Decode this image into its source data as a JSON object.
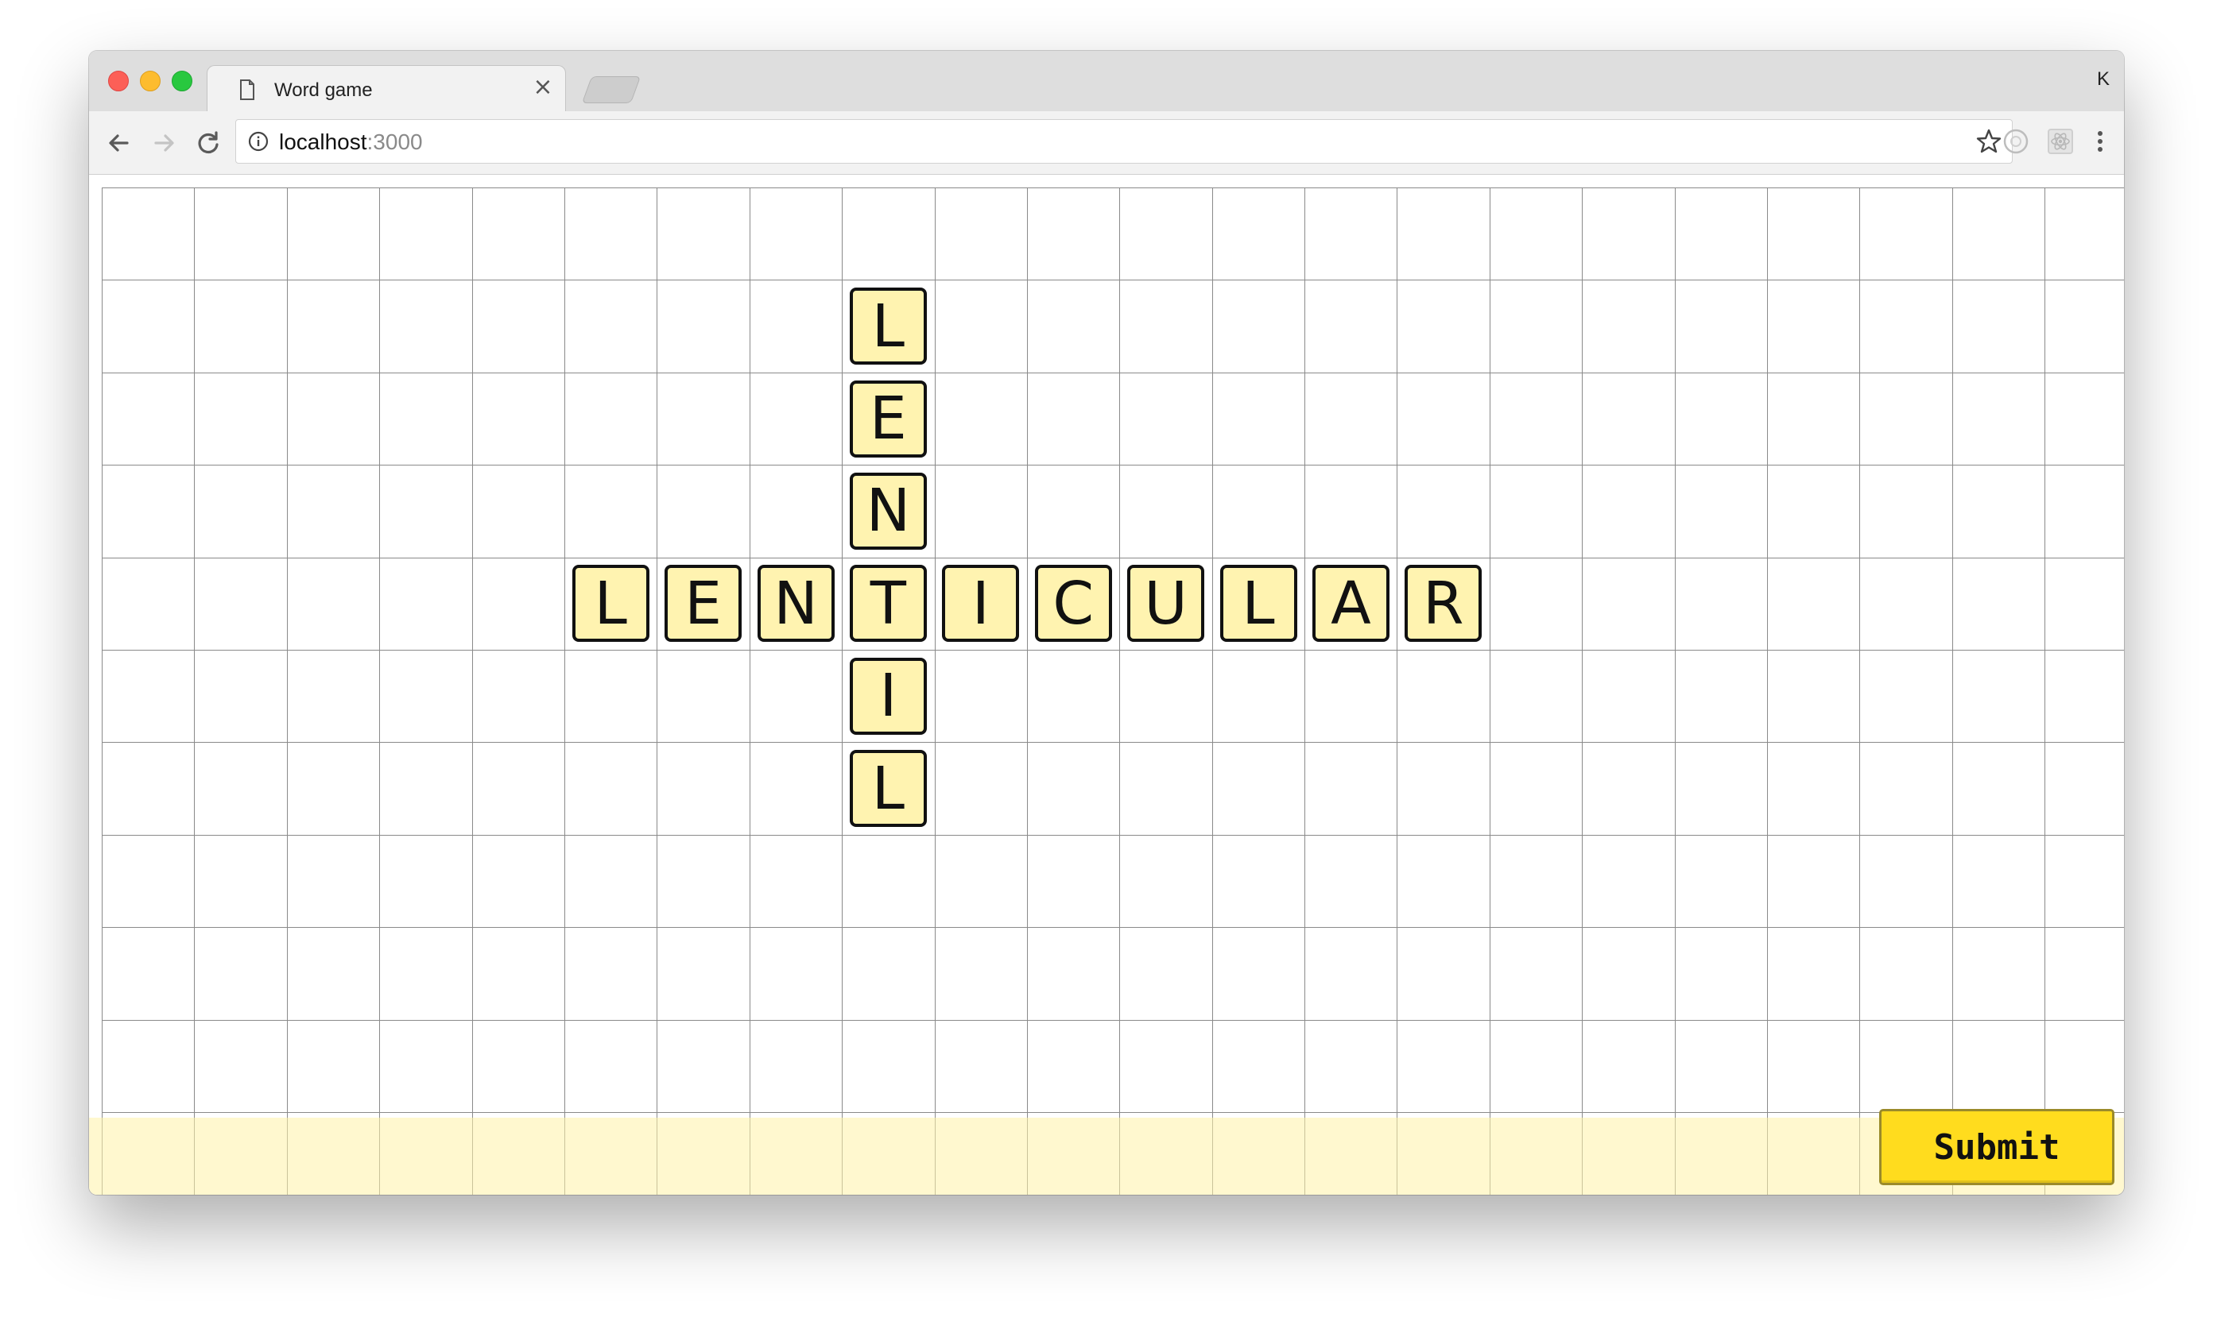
{
  "browser": {
    "tab_title": "Word game",
    "tab_close": "×",
    "profile_initial": "K",
    "url_host": "localhost",
    "url_port": ":3000"
  },
  "game": {
    "words": [
      "LENTICULAR",
      "LENTIL"
    ],
    "tiles": [
      {
        "letter": "L",
        "col": 8,
        "row": 1
      },
      {
        "letter": "E",
        "col": 8,
        "row": 2
      },
      {
        "letter": "N",
        "col": 8,
        "row": 3
      },
      {
        "letter": "L",
        "col": 5,
        "row": 4
      },
      {
        "letter": "E",
        "col": 6,
        "row": 4
      },
      {
        "letter": "N",
        "col": 7,
        "row": 4
      },
      {
        "letter": "T",
        "col": 8,
        "row": 4
      },
      {
        "letter": "I",
        "col": 9,
        "row": 4
      },
      {
        "letter": "C",
        "col": 10,
        "row": 4
      },
      {
        "letter": "U",
        "col": 11,
        "row": 4
      },
      {
        "letter": "L",
        "col": 12,
        "row": 4
      },
      {
        "letter": "A",
        "col": 13,
        "row": 4
      },
      {
        "letter": "R",
        "col": 14,
        "row": 4
      },
      {
        "letter": "I",
        "col": 8,
        "row": 5
      },
      {
        "letter": "L",
        "col": 8,
        "row": 6
      }
    ],
    "submit_label": "Submit"
  },
  "colors": {
    "tile_fill": "#fff3b0",
    "tile_border": "#111111",
    "grid_line": "#8a8a8a",
    "rack_fill": "#fff7cc",
    "submit_fill": "#ffdc1e"
  },
  "icons": [
    "document-icon",
    "close-icon",
    "back-arrow-icon",
    "forward-arrow-icon",
    "reload-icon",
    "info-icon",
    "star-icon",
    "extension-icon",
    "react-devtools-icon",
    "menu-icon"
  ]
}
